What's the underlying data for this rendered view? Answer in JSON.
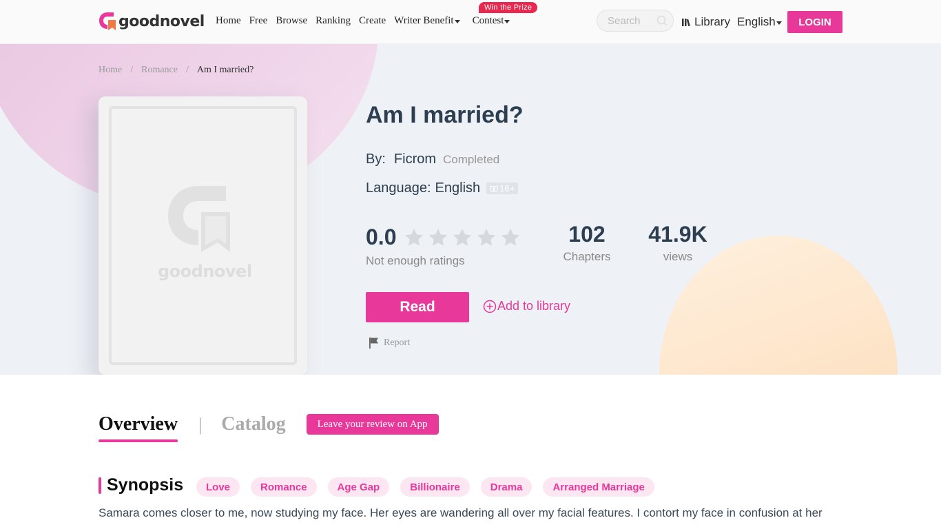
{
  "header": {
    "logo_text": "goodnovel",
    "nav": [
      {
        "label": "Home"
      },
      {
        "label": "Free"
      },
      {
        "label": "Browse"
      },
      {
        "label": "Ranking"
      },
      {
        "label": "Create"
      },
      {
        "label": "Writer Benefit",
        "dropdown": true
      },
      {
        "label": "Contest",
        "dropdown": true
      }
    ],
    "prize_badge": "Win the Prize",
    "search_placeholder": "Search",
    "library_label": "Library",
    "language_label": "English",
    "login_label": "LOGIN"
  },
  "breadcrumb": {
    "home": "Home",
    "category": "Romance",
    "current": "Am I married?",
    "separator": "/"
  },
  "book": {
    "title": "Am I married?",
    "by_label": "By:",
    "author": "Ficrom",
    "status": "Completed",
    "language_label": "Language:",
    "language": "English",
    "age_rating": "16+",
    "cover_text": "goodnovel",
    "rating": "0.0",
    "rating_note": "Not enough ratings",
    "stars_filled": 0,
    "stars_total": 5,
    "chapters": "102",
    "chapters_label": "Chapters",
    "views": "41.9K",
    "views_label": "views",
    "read_label": "Read",
    "add_library_label": "Add to library",
    "report_label": "Report"
  },
  "tabs": {
    "overview": "Overview",
    "separator": "|",
    "catalog": "Catalog",
    "review_button": "Leave your review on App"
  },
  "synopsis": {
    "title": "Synopsis",
    "tags": [
      "Love",
      "Romance",
      "Age Gap",
      "Billionaire",
      "Drama",
      "Arranged Marriage"
    ],
    "text": "Samara comes closer to me, now studying my face. Her eyes are wandering all over my facial features. I contort my face in confusion at her"
  },
  "colors": {
    "accent": "#e8399a",
    "prize": "#e8284f",
    "hero_bg": "#eef1f5"
  }
}
